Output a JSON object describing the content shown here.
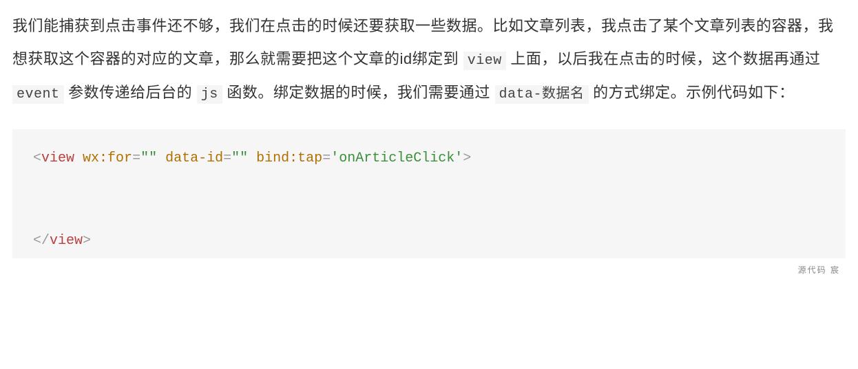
{
  "paragraph": {
    "t1": "我们能捕获到点击事件还不够，我们在点击的时候还要获取一些数据。比如文章列表，我点击了某个文章列表的容器，我想获取这个容器的对应的文章，那么就需要把这个文章的id绑定到 ",
    "code1": "view",
    "t2": " 上面，以后我在点击的时候，这个数据再通过 ",
    "code2": "event",
    "t3": " 参数传递给后台的 ",
    "code3": "js",
    "t4": " 函数。绑定数据的时候，我们需要通过 ",
    "code4": "data-数据名",
    "t5": " 的方式绑定。示例代码如下："
  },
  "code": {
    "open_lt": "<",
    "tag_open": "view",
    "sp1": " ",
    "attr1": "wx:for",
    "eq": "=",
    "val1": "\"\"",
    "sp2": " ",
    "attr2": "data-id",
    "val2": "\"\"",
    "sp3": " ",
    "attr3": "bind:tap",
    "val3": "'onArticleClick'",
    "open_gt": ">",
    "blank": "",
    "close_lt": "</",
    "tag_close": "view",
    "close_gt": ">"
  },
  "footer": "源代码  宸"
}
